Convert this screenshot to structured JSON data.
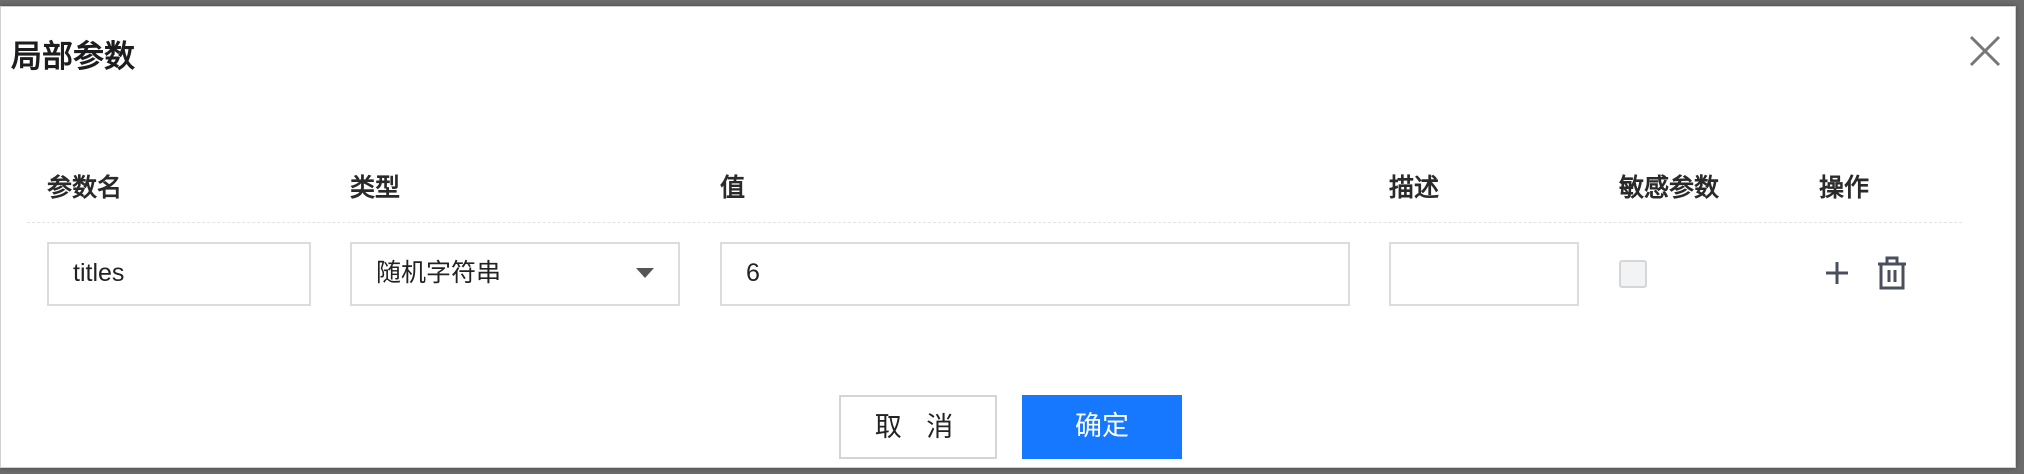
{
  "dialog": {
    "title": "局部参数"
  },
  "table": {
    "headers": {
      "name": "参数名",
      "type": "类型",
      "value": "值",
      "desc": "描述",
      "sensitive": "敏感参数",
      "action": "操作"
    },
    "rows": [
      {
        "name": "titles",
        "type": "随机字符串",
        "value": "6",
        "desc": "",
        "sensitive": false
      }
    ]
  },
  "footer": {
    "cancel_label": "取 消",
    "ok_label": "确定"
  },
  "colors": {
    "primary": "#1677ff"
  },
  "icons": [
    "close-icon",
    "chevron-down-icon",
    "plus-icon",
    "trash-icon"
  ]
}
